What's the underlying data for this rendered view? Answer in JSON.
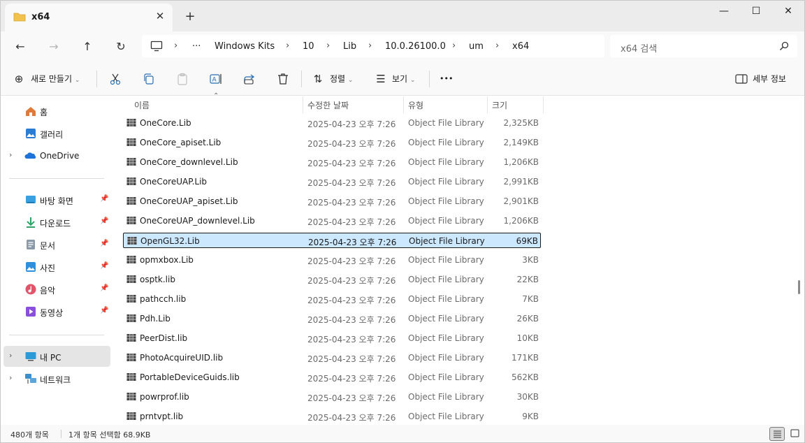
{
  "window": {
    "tab_title": "x64",
    "tab_close": "✕",
    "new_tab": "+",
    "minimize": "—",
    "maximize": "☐",
    "close": "✕"
  },
  "nav": {
    "back": "←",
    "forward": "→",
    "up": "↑",
    "refresh": "↻",
    "overflow": "···",
    "breadcrumbs": [
      "Windows Kits",
      "10",
      "Lib",
      "10.0.26100.0",
      "um",
      "x64"
    ],
    "search_placeholder": "x64 검색"
  },
  "commands": {
    "new_label": "새로 만들기",
    "sort_label": "정렬",
    "view_label": "보기",
    "more": "•••",
    "details_label": "세부 정보",
    "icons": [
      "cut-icon",
      "copy-icon",
      "paste-icon",
      "rename-icon",
      "share-icon",
      "delete-icon"
    ]
  },
  "sidebar": {
    "top_items": [
      {
        "label": "홈",
        "icon": "home-icon",
        "color": "#e07a3a"
      },
      {
        "label": "갤러리",
        "icon": "gallery-icon",
        "color": "#2b7cd3"
      },
      {
        "label": "OneDrive",
        "icon": "onedrive-icon",
        "color": "#1e73d8"
      }
    ],
    "pinned_items": [
      {
        "label": "바탕 화면",
        "icon": "desktop-icon",
        "color": "#3aa0e0"
      },
      {
        "label": "다운로드",
        "icon": "download-icon",
        "color": "#2ea36a"
      },
      {
        "label": "문서",
        "icon": "documents-icon",
        "color": "#8a99a8"
      },
      {
        "label": "사진",
        "icon": "pictures-icon",
        "color": "#2f8fd8"
      },
      {
        "label": "음악",
        "icon": "music-icon",
        "color": "#e0556a"
      },
      {
        "label": "동영상",
        "icon": "videos-icon",
        "color": "#8a4fd8"
      }
    ],
    "drives": [
      {
        "label": "내 PC",
        "icon": "this-pc-icon",
        "color": "#2b9ad6"
      },
      {
        "label": "네트워크",
        "icon": "network-icon",
        "color": "#3c8fc9"
      }
    ]
  },
  "columns": {
    "name": "이름",
    "date": "수정한 날짜",
    "type": "유형",
    "size": "크기"
  },
  "files": [
    {
      "name": "OneCore.Lib",
      "date": "2025-04-23 오후 7:26",
      "type": "Object File Library",
      "size": "2,325KB"
    },
    {
      "name": "OneCore_apiset.Lib",
      "date": "2025-04-23 오후 7:26",
      "type": "Object File Library",
      "size": "2,149KB"
    },
    {
      "name": "OneCore_downlevel.Lib",
      "date": "2025-04-23 오후 7:26",
      "type": "Object File Library",
      "size": "1,206KB"
    },
    {
      "name": "OneCoreUAP.Lib",
      "date": "2025-04-23 오후 7:26",
      "type": "Object File Library",
      "size": "2,991KB"
    },
    {
      "name": "OneCoreUAP_apiset.Lib",
      "date": "2025-04-23 오후 7:26",
      "type": "Object File Library",
      "size": "2,901KB"
    },
    {
      "name": "OneCoreUAP_downlevel.Lib",
      "date": "2025-04-23 오후 7:26",
      "type": "Object File Library",
      "size": "1,206KB"
    },
    {
      "name": "OpenGL32.Lib",
      "date": "2025-04-23 오후 7:26",
      "type": "Object File Library",
      "size": "69KB",
      "selected": true
    },
    {
      "name": "opmxbox.Lib",
      "date": "2025-04-23 오후 7:26",
      "type": "Object File Library",
      "size": "3KB"
    },
    {
      "name": "osptk.lib",
      "date": "2025-04-23 오후 7:26",
      "type": "Object File Library",
      "size": "22KB"
    },
    {
      "name": "pathcch.lib",
      "date": "2025-04-23 오후 7:26",
      "type": "Object File Library",
      "size": "7KB"
    },
    {
      "name": "Pdh.Lib",
      "date": "2025-04-23 오후 7:26",
      "type": "Object File Library",
      "size": "26KB"
    },
    {
      "name": "PeerDist.lib",
      "date": "2025-04-23 오후 7:26",
      "type": "Object File Library",
      "size": "10KB"
    },
    {
      "name": "PhotoAcquireUID.lib",
      "date": "2025-04-23 오후 7:26",
      "type": "Object File Library",
      "size": "171KB"
    },
    {
      "name": "PortableDeviceGuids.lib",
      "date": "2025-04-23 오후 7:26",
      "type": "Object File Library",
      "size": "562KB"
    },
    {
      "name": "powrprof.lib",
      "date": "2025-04-23 오후 7:26",
      "type": "Object File Library",
      "size": "30KB"
    },
    {
      "name": "prntvpt.lib",
      "date": "2025-04-23 오후 7:26",
      "type": "Object File Library",
      "size": "9KB"
    }
  ],
  "status": {
    "item_count": "480개 항목",
    "selection": "1개 항목 선택함 68.9KB"
  },
  "colors": {
    "selection_bg": "#cce8ff",
    "folder": "#f2c14e"
  }
}
